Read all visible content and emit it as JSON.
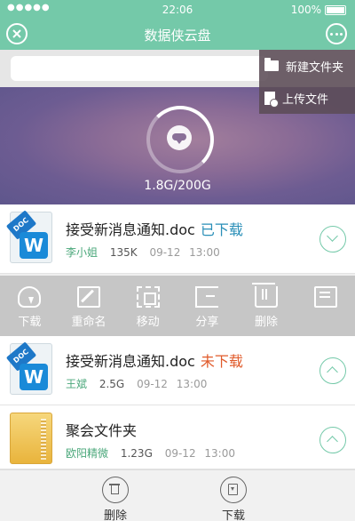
{
  "status_bar": {
    "signal": "●●●●●",
    "time": "22:06",
    "battery": "100%"
  },
  "header": {
    "title": "数据侠云盘"
  },
  "search": {
    "placeholder": ""
  },
  "menu": {
    "items": [
      {
        "label": "新建文件夹",
        "icon": "folder-icon"
      },
      {
        "label": "上传文件",
        "icon": "upload-file-icon"
      }
    ]
  },
  "banner": {
    "storage": "1.8G/200G",
    "icon": "cloud-download-icon"
  },
  "files": [
    {
      "name": "接受新消息通知.doc",
      "status": "已下载",
      "status_color": "#2a8fb8",
      "owner": "李小姐",
      "size": "135K",
      "date": "09-12",
      "time": "13:00",
      "type": "doc",
      "expanded": true
    },
    {
      "name": "接受新消息通知.doc",
      "status": "未下载",
      "status_color": "#e05a2a",
      "owner": "王斌",
      "size": "2.5G",
      "date": "09-12",
      "time": "13:00",
      "type": "doc",
      "expanded": false
    },
    {
      "name": "聚会文件夹",
      "status": "",
      "status_color": "",
      "owner": "欧阳精微",
      "size": "1.23G",
      "date": "09-12",
      "time": "13:00",
      "type": "folder",
      "expanded": false
    }
  ],
  "actions": [
    "下载",
    "重命名",
    "移动",
    "分享",
    "删除"
  ],
  "bottom": {
    "delete_label": "删除",
    "download_label": "下载"
  },
  "colors": {
    "accent": "#74c9a9",
    "action_bar": "#c6c6c6"
  }
}
